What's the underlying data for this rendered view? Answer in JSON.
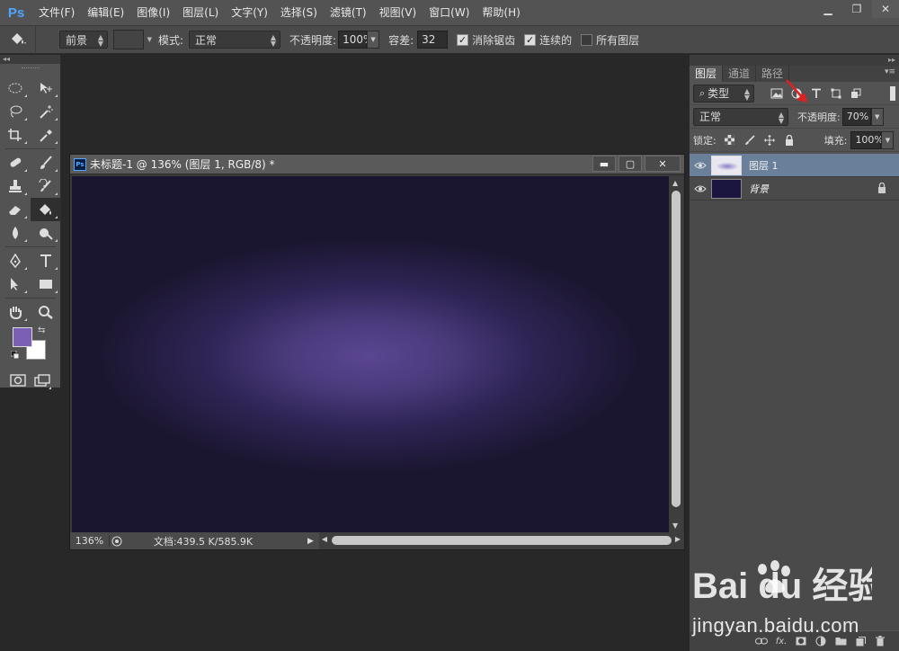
{
  "app": {
    "logo": "Ps",
    "menu": [
      "文件(F)",
      "编辑(E)",
      "图像(I)",
      "图层(L)",
      "文字(Y)",
      "选择(S)",
      "滤镜(T)",
      "视图(V)",
      "窗口(W)",
      "帮助(H)"
    ],
    "window_controls": {
      "minimize": "▁",
      "restore": "❐",
      "close": "✕"
    }
  },
  "options": {
    "fill_source": "前景",
    "mode_label": "模式:",
    "mode_value": "正常",
    "opacity_label": "不透明度:",
    "opacity_value": "100%",
    "tolerance_label": "容差:",
    "tolerance_value": "32",
    "antialias_label": "消除锯齿",
    "antialias_checked": true,
    "contiguous_label": "连续的",
    "contiguous_checked": true,
    "all_layers_label": "所有图层",
    "all_layers_checked": false
  },
  "toolbar": {
    "collapse": "◂◂",
    "foreground_color": "#7b5fb4",
    "background_color": "#ffffff"
  },
  "document": {
    "title": "未标题-1 @ 136% (图层 1, RGB/8) *",
    "ps_badge": "Ps",
    "buttons": {
      "minimize": "▬",
      "maximize": "▢",
      "close": "✕"
    },
    "zoom": "136%",
    "doc_info": "文档:439.5 K/585.9K",
    "canvas_color": "#1b1630",
    "glow_color": "#5a4691"
  },
  "layers_panel": {
    "collapse": "▸▸",
    "tabs": [
      "图层",
      "通道",
      "路径"
    ],
    "filter_label": "类型",
    "blend_mode": "正常",
    "opacity_label": "不透明度:",
    "opacity_value": "70%",
    "lock_label": "锁定:",
    "fill_label": "填充:",
    "fill_value": "100%",
    "layers": [
      {
        "name": "图层 1",
        "selected": true,
        "thumb": "#8b7fc4"
      },
      {
        "name": "背景",
        "selected": false,
        "thumb": "#1b1640",
        "locked": true
      }
    ],
    "footer_icons": [
      "link-icon",
      "fx-icon",
      "mask-icon",
      "adjustment-icon",
      "folder-icon",
      "new-layer-icon",
      "trash-icon"
    ],
    "fx_label": "fx."
  },
  "watermark": {
    "brand": "Bai du 经验",
    "url": "jingyan.baidu.com"
  }
}
